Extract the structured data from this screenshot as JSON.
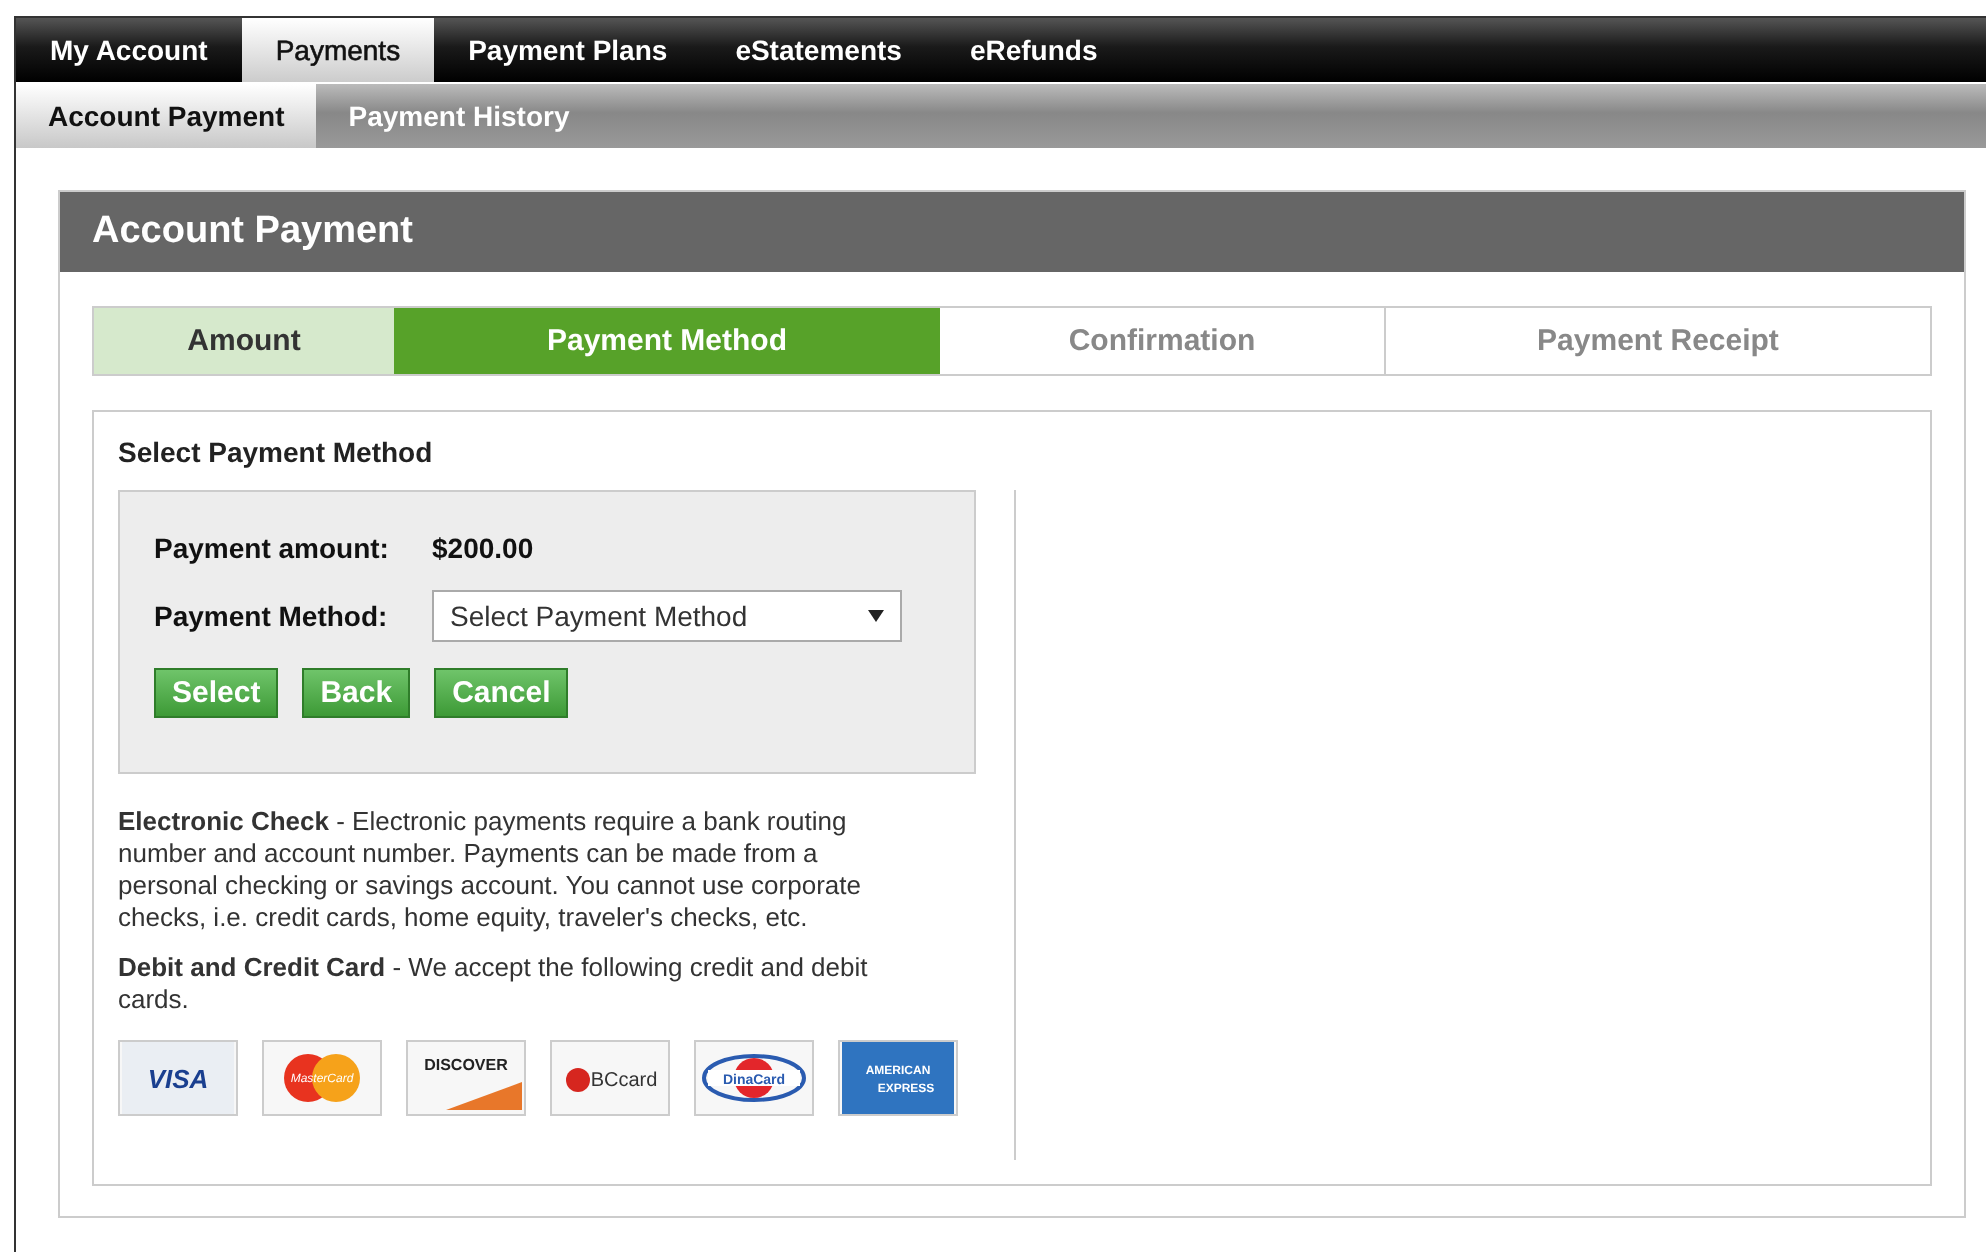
{
  "top_nav": [
    {
      "label": "My Account",
      "selected": false
    },
    {
      "label": "Payments",
      "selected": true
    },
    {
      "label": "Payment Plans",
      "selected": false
    },
    {
      "label": "eStatements",
      "selected": false
    },
    {
      "label": "eRefunds",
      "selected": false
    }
  ],
  "sub_nav": [
    {
      "label": "Account Payment",
      "selected": true
    },
    {
      "label": "Payment History",
      "selected": false
    }
  ],
  "panel": {
    "title": "Account Payment",
    "steps": [
      {
        "label": "Amount",
        "kind": "done"
      },
      {
        "label": "Payment Method",
        "kind": "current"
      },
      {
        "label": "Confirmation",
        "kind": "todo"
      },
      {
        "label": "Payment Receipt",
        "kind": "todo"
      }
    ],
    "section_title": "Select Payment Method",
    "form": {
      "amount_label": "Payment amount:",
      "amount": "$200.00",
      "method_label": "Payment Method:",
      "method_value": "Select Payment Method",
      "buttons": [
        "Select",
        "Back",
        "Cancel"
      ]
    },
    "notes": [
      "**Electronic Check** - Electronic payments require a bank routing number and account number. Payments can be made from a personal checking or savings account. You cannot use corporate checks, i.e. credit cards, home equity, traveler's checks, etc.",
      "**Debit and Credit Card** - We accept the following credit and debit cards."
    ],
    "cards": [
      {
        "kind": "visa",
        "label": "VISA"
      },
      {
        "kind": "mastercard",
        "label": "MasterCard"
      },
      {
        "kind": "discover",
        "label": "DISCOVER"
      },
      {
        "kind": "bccard",
        "label": "BCcard"
      },
      {
        "kind": "dinacard",
        "label": "DinaCard"
      },
      {
        "kind": "amex",
        "label": "AMERICAN EXPRESS"
      }
    ]
  }
}
